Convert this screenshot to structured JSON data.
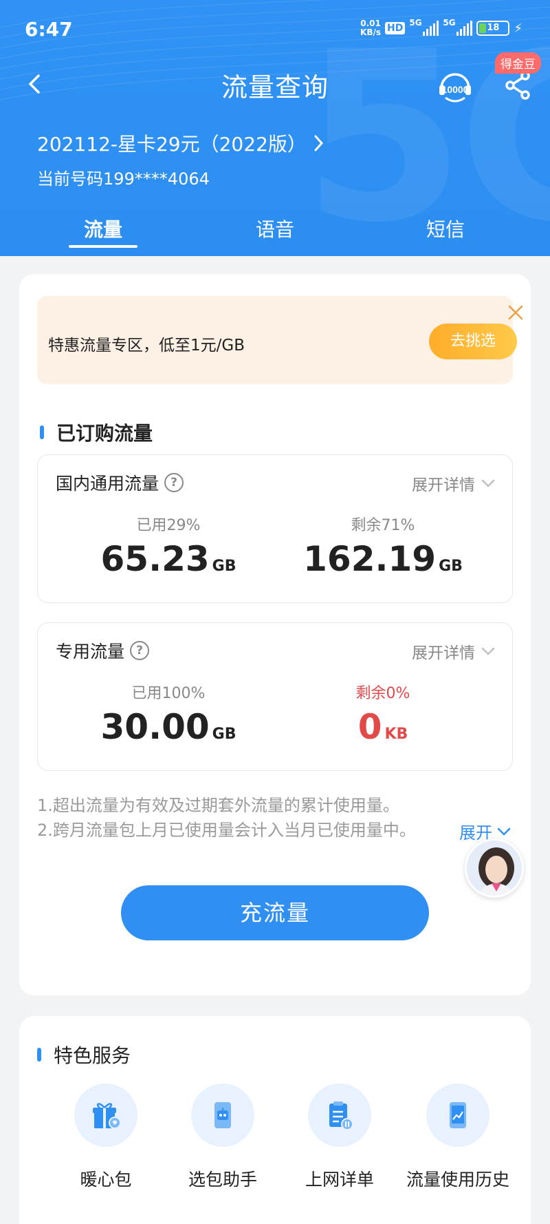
{
  "status_bar": {
    "time": "6:47",
    "net_speed_value": "0.01",
    "net_speed_unit": "KB/s",
    "hd_label": "HD",
    "signal_1_label": "5G",
    "signal_2_label": "5G",
    "battery": "18"
  },
  "nav": {
    "title": "流量查询",
    "service_number": "10000",
    "badge": "得金豆"
  },
  "plan": {
    "name": "202112-星卡29元（2022版）",
    "phone": "当前号码199****4064"
  },
  "tabs": [
    {
      "label": "流量",
      "active": true
    },
    {
      "label": "语音",
      "active": false
    },
    {
      "label": "短信",
      "active": false
    }
  ],
  "promo": {
    "text": "特惠流量专区，低至1元/GB",
    "button": "去挑选"
  },
  "subscribed": {
    "heading": "已订购流量",
    "expand_label": "展开详情",
    "domestic": {
      "title": "国内通用流量",
      "used_pct": "已用29%",
      "used_value": "65.23",
      "used_unit": "GB",
      "remain_pct": "剩余71%",
      "remain_value": "162.19",
      "remain_unit": "GB"
    },
    "special": {
      "title": "专用流量",
      "used_pct": "已用100%",
      "used_value": "30.00",
      "used_unit": "GB",
      "remain_pct": "剩余0%",
      "remain_value": "0",
      "remain_unit": "KB"
    }
  },
  "notes": {
    "line1": "1.超出流量为有效及过期套外流量的累计使用量。",
    "line2": "2.跨月流量包上月已使用量会计入当月已使用量中。",
    "expand": "展开"
  },
  "topup_button": "充流量",
  "services": {
    "heading": "特色服务",
    "items": [
      {
        "label": "暖心包",
        "icon": "gift-icon"
      },
      {
        "label": "选包助手",
        "icon": "robot-phone-icon"
      },
      {
        "label": "上网详单",
        "icon": "clipboard-icon"
      },
      {
        "label": "流量使用历史",
        "icon": "chart-phone-icon"
      }
    ]
  },
  "colors": {
    "header_blue": "#2f92f4",
    "accent_blue": "#2f8ff2",
    "warn_red": "#e24a4a",
    "promo_orange": "#ffad2a"
  }
}
